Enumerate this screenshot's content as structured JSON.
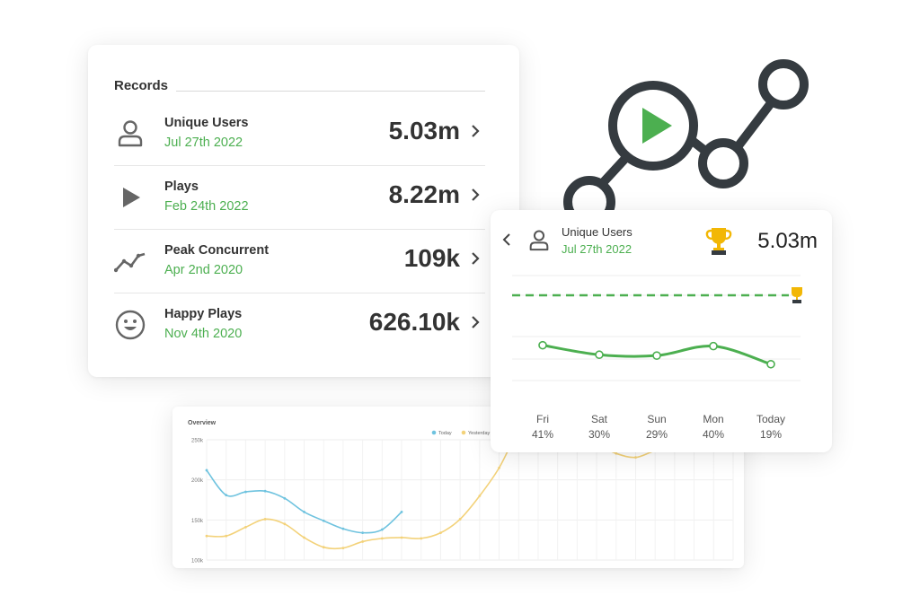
{
  "records": {
    "title": "Records",
    "items": [
      {
        "name": "Unique Users",
        "date": "Jul 27th 2022",
        "value": "5.03m",
        "icon": "user-icon"
      },
      {
        "name": "Plays",
        "date": "Feb 24th 2022",
        "value": "8.22m",
        "icon": "play-icon"
      },
      {
        "name": "Peak Concurrent",
        "date": "Apr 2nd 2020",
        "value": "109k",
        "icon": "trend-icon"
      },
      {
        "name": "Happy Plays",
        "date": "Nov 4th 2020",
        "value": "626.10k",
        "icon": "smiley-icon"
      }
    ]
  },
  "detail": {
    "name": "Unique Users",
    "date": "Jul 27th 2022",
    "value": "5.03m",
    "days": [
      {
        "day": "Fri",
        "pct": "41%"
      },
      {
        "day": "Sat",
        "pct": "30%"
      },
      {
        "day": "Sun",
        "pct": "29%"
      },
      {
        "day": "Mon",
        "pct": "40%"
      },
      {
        "day": "Today",
        "pct": "19%"
      }
    ]
  },
  "chart_data": [
    {
      "type": "line",
      "title": "Overview",
      "yticks": [
        "250k",
        "200k",
        "150k",
        "100k"
      ],
      "ylim": [
        100,
        250
      ],
      "legend": "top-right",
      "series": [
        {
          "name": "Today",
          "color": "#6fc3df",
          "values": [
            212,
            181,
            185,
            186,
            177,
            160,
            149,
            139,
            134,
            138,
            160
          ]
        },
        {
          "name": "Yesterday",
          "color": "#f3d27a",
          "values": [
            130,
            130,
            141,
            151,
            145,
            128,
            116,
            115,
            123,
            127,
            128,
            127,
            134,
            151,
            180,
            215,
            262,
            290,
            280,
            262,
            245,
            233,
            228,
            236,
            236,
            245,
            245,
            240
          ]
        }
      ]
    },
    {
      "type": "line",
      "categories": [
        "Fri",
        "Sat",
        "Sun",
        "Mon",
        "Today"
      ],
      "series": [
        {
          "name": "Unique Users",
          "color": "#4caf50",
          "values": [
            41,
            30,
            29,
            40,
            19
          ]
        }
      ],
      "record_line": 100
    }
  ],
  "colors": {
    "accent": "#4caf50",
    "dark": "#353b40",
    "trophy": "#f2b705"
  }
}
